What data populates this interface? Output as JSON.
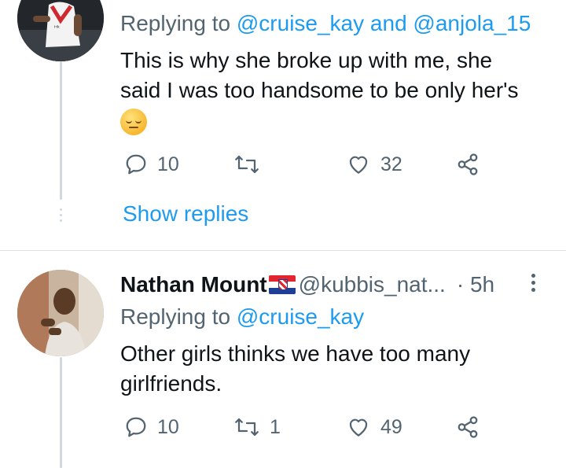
{
  "tweet1": {
    "replying_label": "Replying to",
    "mention1": "@cruise_kay",
    "and_label": "and",
    "mention2": "@anjola_15",
    "text_line1": "This is why she broke up with me, she",
    "text_line2": "said I was too handsome to be only her's",
    "emoji": "pensive-face",
    "reply_count": "10",
    "retweet_count": "",
    "like_count": "32",
    "show_replies": "Show replies"
  },
  "tweet2": {
    "name": "Nathan Mount",
    "flag": "croatia-flag",
    "handle": "@kubbis_nat...",
    "time": "· 5h",
    "replying_label": "Replying to",
    "mention": "@cruise_kay",
    "text_line1": "Other girls thinks we have too many",
    "text_line2": "girlfriends.",
    "reply_count": "10",
    "retweet_count": "1",
    "like_count": "49"
  },
  "colors": {
    "link": "#1d9bf0",
    "secondary_text": "#536471",
    "thread_line": "#cfd9de"
  }
}
